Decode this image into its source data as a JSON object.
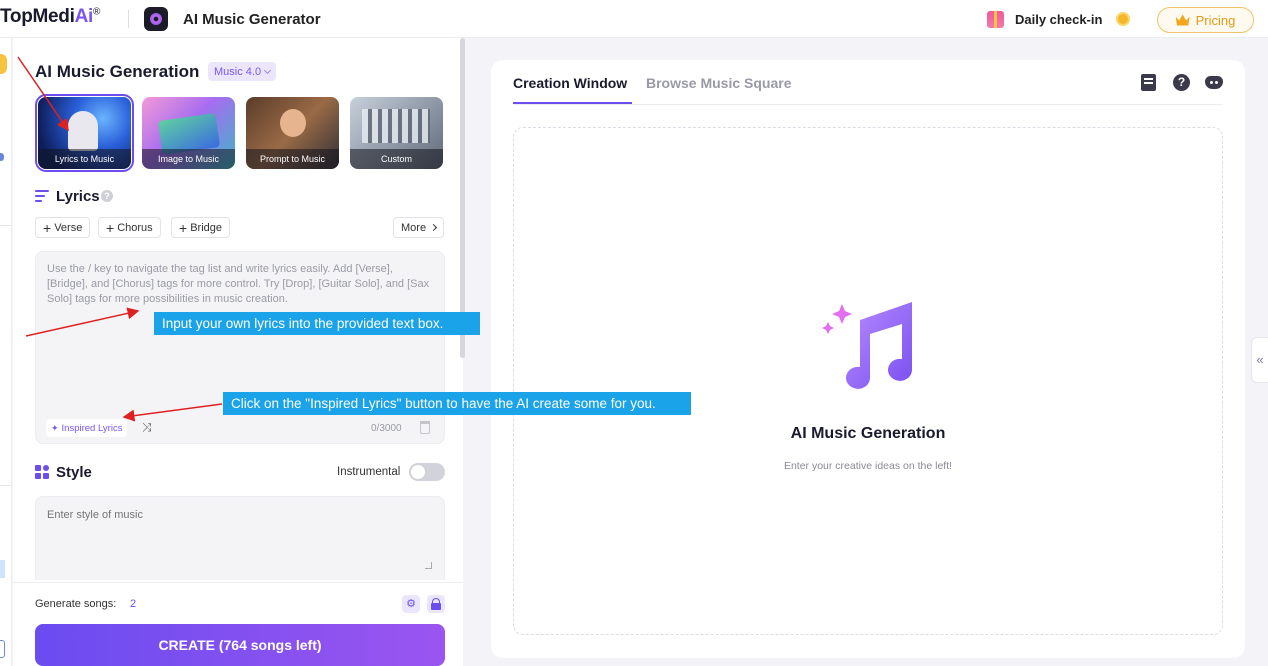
{
  "header": {
    "logo_main": "TopMedi",
    "logo_ai": "Ai",
    "logo_reg": "®",
    "app_title": "AI Music Generator",
    "daily_checkin": "Daily check-in",
    "pricing": "Pricing"
  },
  "left": {
    "section_title": "AI Music Generation",
    "version": "Music 4.0",
    "modes": [
      {
        "label": "Lyrics to Music",
        "active": true
      },
      {
        "label": "Image to Music",
        "active": false
      },
      {
        "label": "Prompt to Music",
        "active": false
      },
      {
        "label": "Custom",
        "active": false
      }
    ],
    "lyrics_label": "Lyrics",
    "help_glyph": "?",
    "tags": [
      "Verse",
      "Chorus",
      "Bridge"
    ],
    "more_label": "More",
    "lyrics_placeholder": "Use the / key to navigate the tag list and write lyrics easily. Add [Verse], [Bridge], and [Chorus] tags for more control. Try [Drop], [Guitar Solo], and [Sax Solo] tags for more possibilities in music creation.",
    "inspired_label": "Inspired Lyrics",
    "counter": "0/3000",
    "style_label": "Style",
    "instrumental_label": "Instrumental",
    "instrumental_on": false,
    "style_placeholder": "Enter style of music",
    "generate_songs_label": "Generate songs:",
    "generate_songs_count": "2",
    "create_button": "CREATE (764 songs left)"
  },
  "right": {
    "tabs": [
      {
        "label": "Creation Window",
        "active": true
      },
      {
        "label": "Browse Music Square",
        "active": false
      }
    ],
    "help_glyph": "?",
    "area_title": "AI Music Generation",
    "area_subtitle": "Enter your creative ideas on the left!",
    "collapse_glyph": "«"
  },
  "annotations": {
    "callout_1": "Input your own lyrics into the provided text box.",
    "callout_2": "Click on the \"Inspired Lyrics\" button to have the AI create some for you."
  },
  "icons": {
    "app": "music-disc-icon",
    "gift": "gift-icon",
    "coin": "coin-icon",
    "crown": "crown-icon",
    "lyrics": "lyrics-list-icon",
    "style": "style-grid-icon",
    "shuffle": "shuffle-icon",
    "trash": "trash-icon",
    "gear": "gear-icon",
    "lock": "lock-icon",
    "history": "history-doc-icon",
    "help": "help-icon",
    "discord": "discord-icon",
    "music_note": "music-note-icon"
  },
  "colors": {
    "accent": "#6c4ef0",
    "callout": "#1aa3e8",
    "arrow": "#e02020",
    "pricing": "#e19a16"
  }
}
